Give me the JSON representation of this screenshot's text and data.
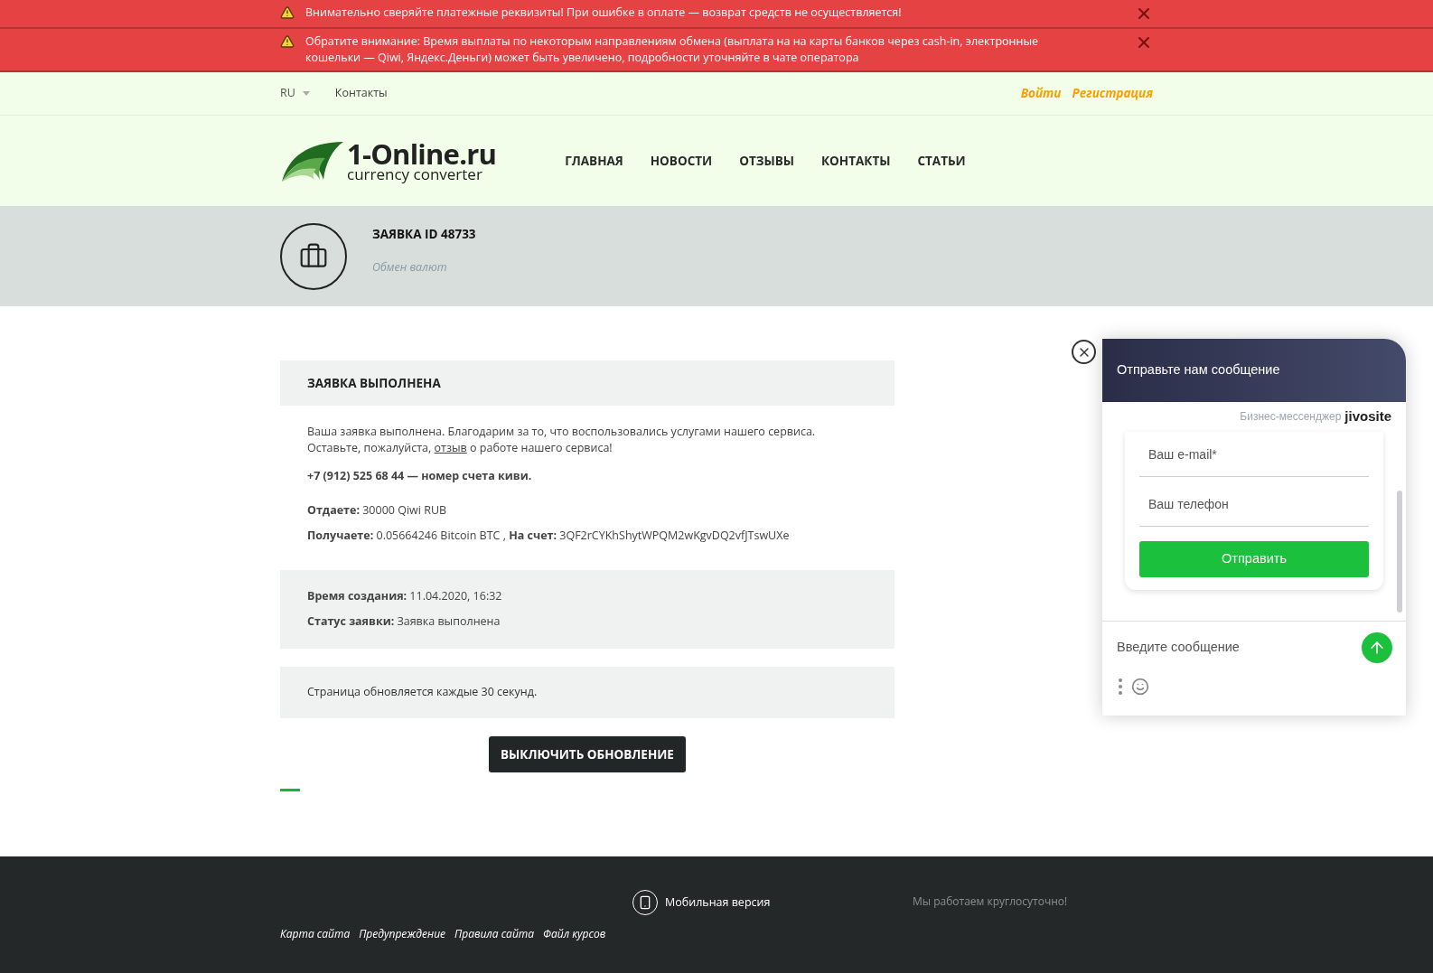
{
  "alerts": [
    {
      "text": "Внимательно сверяйте платежные реквизиты! При ошибке в оплате — возврат средств не осуществляется!"
    },
    {
      "text": "Обратите внимание: Время выплаты по некоторым направлениям обмена (выплата на на карты банков через cash-in, электронные кошельки — Qiwi, Яндекс.Деньги) может быть увеличено, подробности уточняйте в чате оператора"
    }
  ],
  "topbar": {
    "language": "RU",
    "links": [
      "Контакты"
    ],
    "auth": [
      "Войти",
      "Регистрация"
    ]
  },
  "logo": {
    "title": "1-Online.ru",
    "subtitle": "currency converter"
  },
  "nav": [
    "ГЛАВНАЯ",
    "НОВОСТИ",
    "ОТЗЫВЫ",
    "КОНТАКТЫ",
    "СТАТЬИ"
  ],
  "page_header": {
    "title": "ЗАЯВКА ID 48733",
    "subtitle": "Обмен валют"
  },
  "order": {
    "heading": "ЗАЯВКА ВЫПОЛНЕНА",
    "message": {
      "before": "Ваша заявка выполнена. Благодарим за то, что воспользовались услугами нашего сервиса. Оставьте, пожалуйста, ",
      "link": "отзыв",
      "after": " о работе нашего сервиса!"
    },
    "account_note": "+7 (912) 525 68 44 — номер счета киви.",
    "details": [
      "**Отдаете:** 30000 Qiwi RUB",
      "**Получаете:** 0.05664246 Bitcoin BTC , **На счет:** 3QF2rCYKhShytWPQM2wKgvDQ2vfJTswUXe"
    ],
    "meta": [
      "**Время создания:** 11.04.2020, 16:32",
      "**Статус заявки:** Заявка выполнена"
    ],
    "refresh_note": "Страница обновляется каждые 30 секунд.",
    "button": "ВЫКЛЮЧИТЬ ОБНОВЛЕНИЕ"
  },
  "footer": {
    "mobile_link": "Мобильная версия",
    "hours": "Мы работаем круглосуточно!",
    "links": [
      "Карта сайта",
      "Предупреждение",
      "Правила сайта",
      "Файл курсов"
    ]
  },
  "chat": {
    "title": "Отправьте нам сообщение",
    "brand_caption": "Бизнес-мессенджер",
    "brand": "jivosite",
    "fields": [
      {
        "placeholder": "Ваш e-mail*"
      },
      {
        "placeholder": "Ваш телефон"
      }
    ],
    "submit": "Отправить",
    "message_placeholder": "Введите сообщение"
  }
}
